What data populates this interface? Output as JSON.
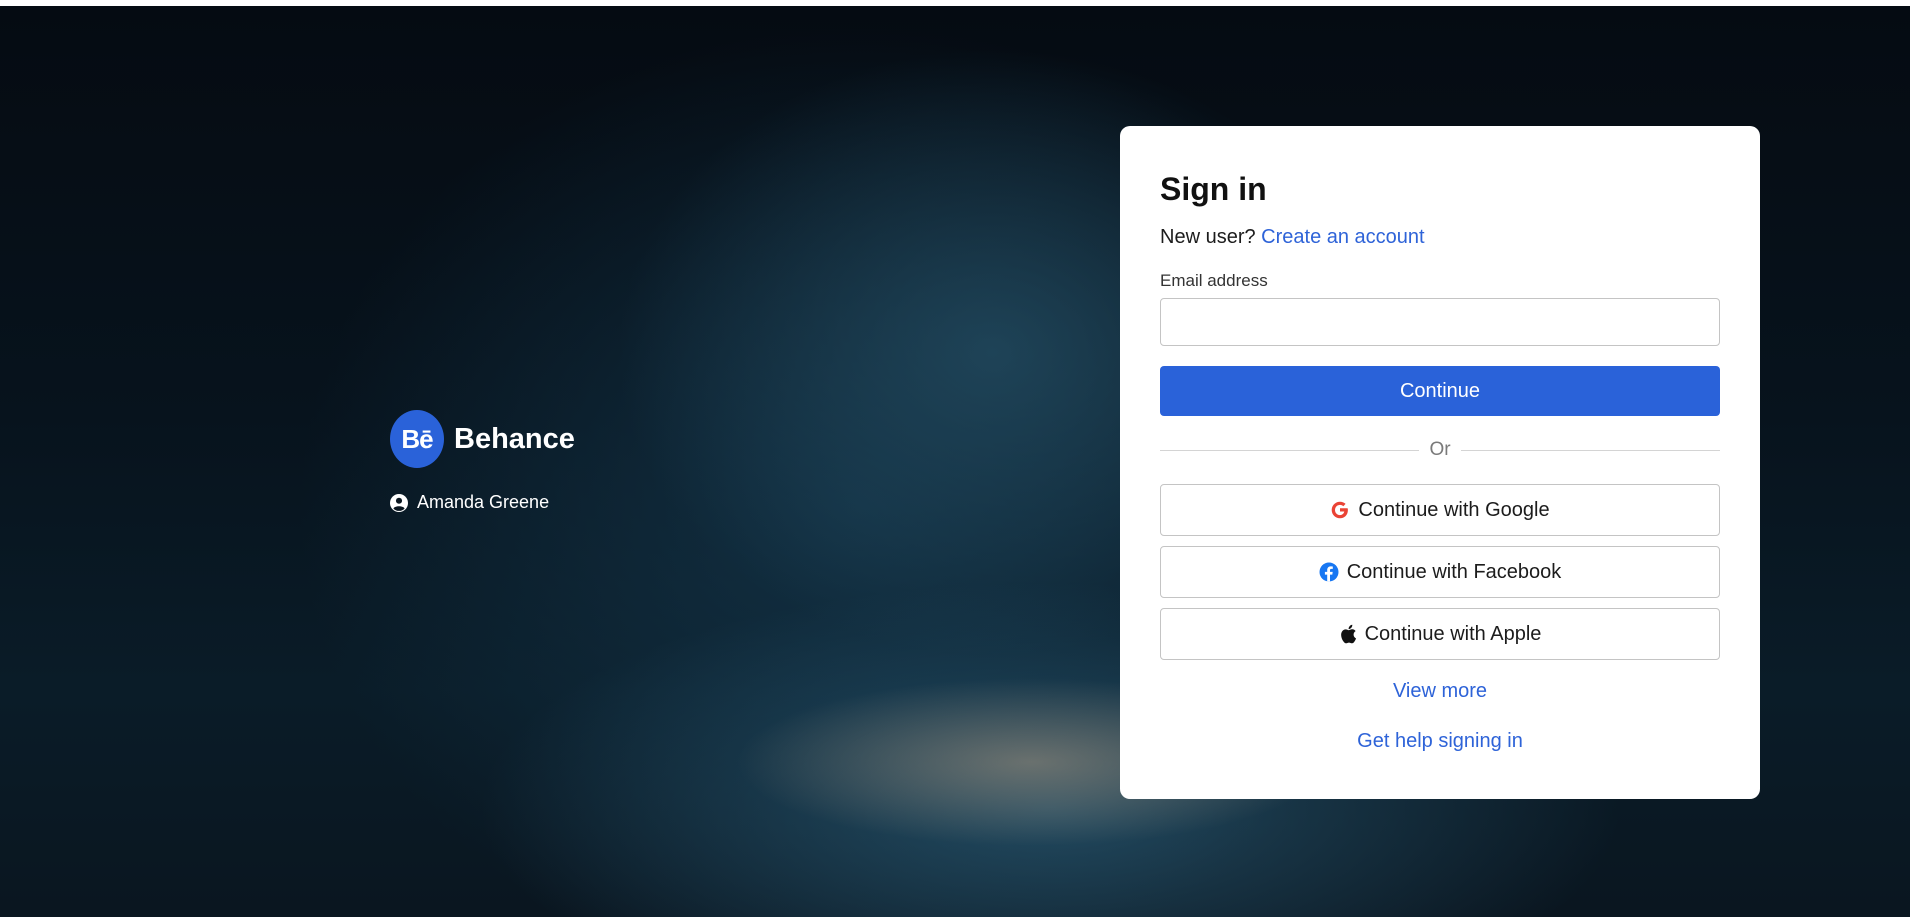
{
  "brand": {
    "logo_text": "Bē",
    "name": "Behance"
  },
  "user": {
    "name": "Amanda Greene",
    "icon": "user-circle-icon"
  },
  "signin": {
    "title": "Sign in",
    "new_user_prompt": "New user?",
    "create_account_label": "Create an account",
    "email_label": "Email address",
    "email_value": "",
    "continue_label": "Continue",
    "divider_text": "Or",
    "google_label": "Continue with Google",
    "facebook_label": "Continue with Facebook",
    "apple_label": "Continue with Apple",
    "view_more_label": "View more",
    "help_label": "Get help signing in"
  },
  "colors": {
    "accent": "#2a62d9",
    "link": "#2e63d8",
    "google_red": "#ea4335",
    "facebook_blue": "#1877f2"
  }
}
